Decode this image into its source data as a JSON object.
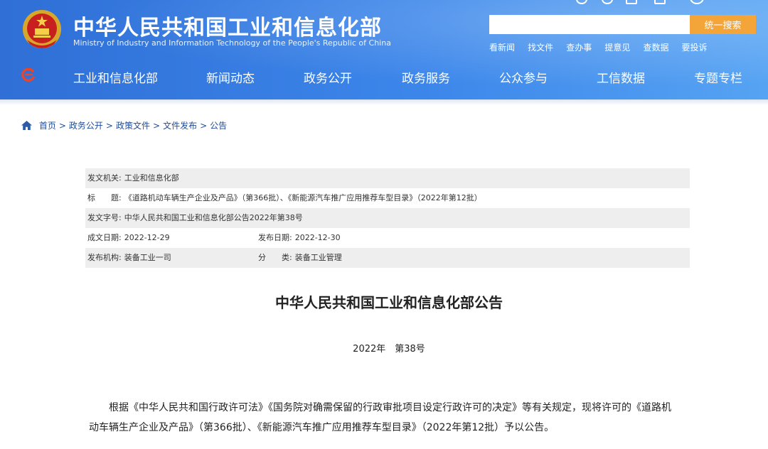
{
  "site": {
    "title": "中华人民共和国工业和信息化部",
    "subtitle": "Ministry of Industry and Information Technology of the People's Republic of China"
  },
  "search": {
    "placeholder": "",
    "button_label": "统一搜索"
  },
  "quick_links": [
    "看新闻",
    "找文件",
    "查办事",
    "提意见",
    "查数据",
    "要投诉"
  ],
  "nav": {
    "items": [
      "工业和信息化部",
      "新闻动态",
      "政务公开",
      "政务服务",
      "公众参与",
      "工信数据",
      "专题专栏"
    ]
  },
  "breadcrumb": [
    "首页",
    "政务公开",
    "政策文件",
    "文件发布",
    "公告"
  ],
  "breadcrumb_separator": ">",
  "meta": {
    "issuer_label": "发文机关:",
    "issuer": "工业和信息化部",
    "subject_label": "标　　题:",
    "subject": "《道路机动车辆生产企业及产品》（第366批）、《新能源汽车推广应用推荐车型目录》（2022年第12批）",
    "doc_no_label": "发文字号:",
    "doc_no": "中华人民共和国工业和信息化部公告2022年第38号",
    "written_date_label": "成文日期:",
    "written_date": "2022-12-29",
    "publish_date_label": "发布日期:",
    "publish_date": "2022-12-30",
    "publisher_label": "发布机构:",
    "publisher": "装备工业一司",
    "category_label": "分　　类:",
    "category": "装备工业管理"
  },
  "document": {
    "title": "中华人民共和国工业和信息化部公告",
    "number": "2022年　第38号",
    "paragraph": "根据《中华人民共和国行政许可法》《国务院对确需保留的行政审批项目设定行政许可的决定》等有关规定，现将许可的《道路机动车辆生产企业及产品》（第366批）、《新能源汽车推广应用推荐车型目录》（2022年第12批）予以公告。"
  },
  "colors": {
    "header_blue": "#3c86ea",
    "search_button": "#f3a53a",
    "link_blue": "#1f4c99"
  }
}
